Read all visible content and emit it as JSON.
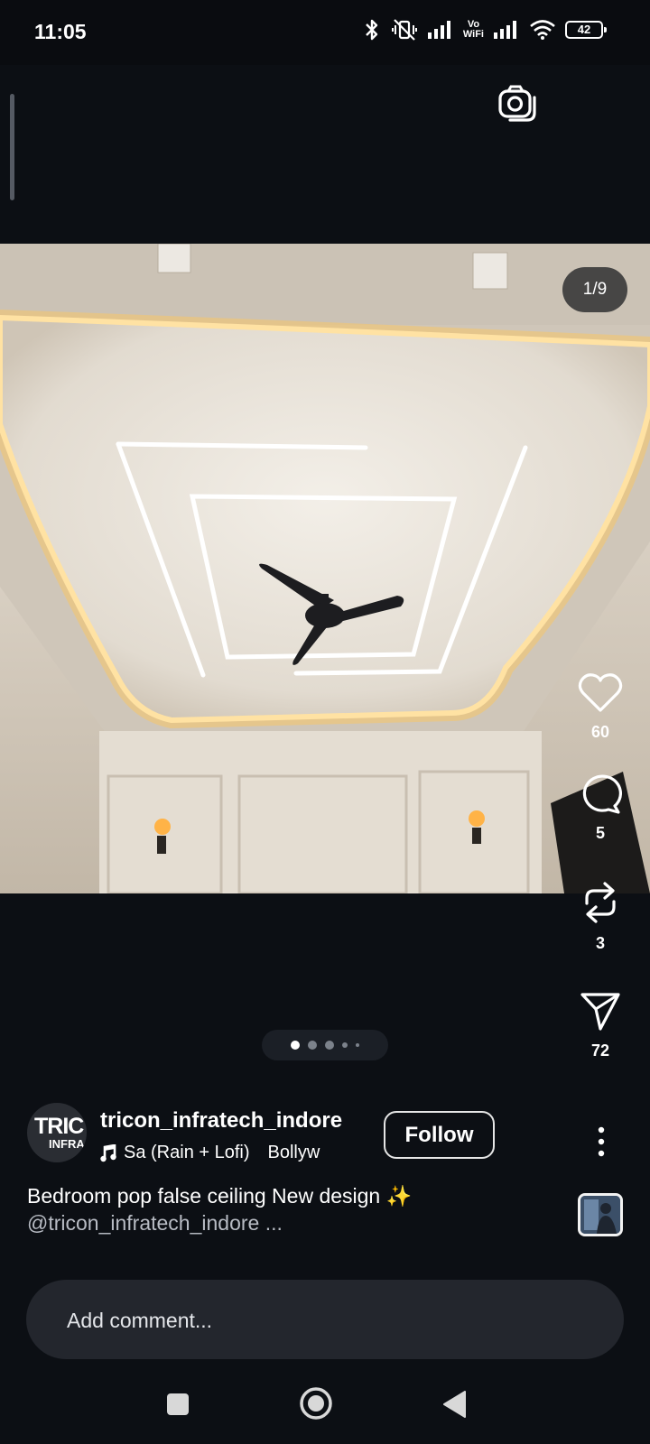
{
  "status_bar": {
    "time": "11:05",
    "vowifi_top": "Vo",
    "vowifi_bottom": "WiFi",
    "battery": "42"
  },
  "post": {
    "page_indicator": "1/9",
    "carousel": {
      "total_dots": 5,
      "active_index": 0
    },
    "actions": {
      "likes": "60",
      "comments": "5",
      "reposts": "3",
      "shares": "72"
    },
    "author": {
      "avatar_text": "TRIC",
      "avatar_subtext": "INFRA",
      "username": "tricon_infratech_indore",
      "follow_label": "Follow"
    },
    "music": {
      "song": "Sa (Rain + Lofi)",
      "artist": "Bollyw"
    },
    "caption": {
      "text": "Bedroom pop false ceiling New design ✨",
      "mention": "@tricon_infratech_indore ..."
    }
  },
  "comment_input": {
    "placeholder": "Add comment..."
  },
  "icons": {
    "camera": "camera-icon",
    "like": "heart-icon",
    "comment": "comment-bubble-icon",
    "repost": "repost-icon",
    "share": "send-icon",
    "more": "more-vertical-icon",
    "music": "music-note-icon"
  },
  "colors": {
    "background": "#0c0f14",
    "accent_text": "#ffffff",
    "secondary_text": "#b8bcc4",
    "input_bg": "#23262d"
  }
}
